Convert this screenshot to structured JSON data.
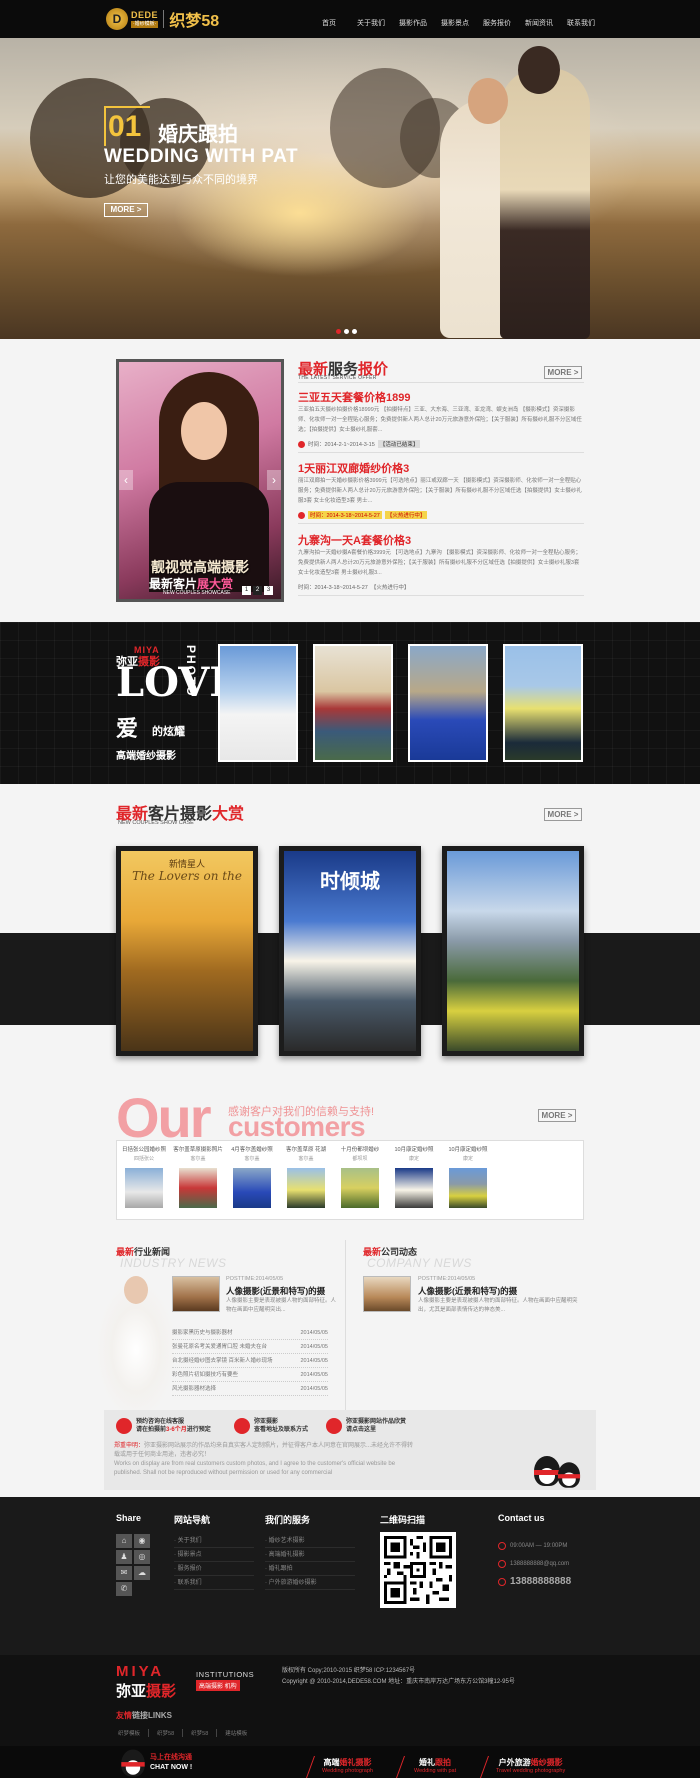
{
  "header": {
    "logo_badge": "D",
    "logo_text": "DEDE",
    "logo_subtext": "·婚纱模板·",
    "logo_name": "织梦58",
    "nav": [
      "首页",
      "关于我们",
      "摄影作品",
      "摄影景点",
      "服务报价",
      "新闻资讯",
      "联系我们"
    ]
  },
  "banner": {
    "number": "01",
    "title_cn": "婚庆跟拍",
    "title_en": "WEDDING WITH PAT",
    "subtitle": "让您的美能达到与众不同的境界",
    "more": "MORE >",
    "active_slide": 1,
    "slides": 3
  },
  "services": {
    "title_red": "最新",
    "title_dark": "服务",
    "title_red2": "报价",
    "title_en": "THE LATEST SERVICE OFFER",
    "more": "MORE >",
    "photo": {
      "caption1": "靓视觉高端摄影",
      "caption2_a": "最新客片",
      "caption2_b": "展大赏",
      "caption3": "NEW COUPLES SHOWCASE",
      "pages": [
        "1",
        "2",
        "3"
      ],
      "active_page": "2",
      "prev": "‹",
      "next": "›"
    },
    "items": [
      {
        "title": "三亚五天套餐价格1899",
        "desc": "三亚拍五天摄纱拍摄价格18999元 【拍摄特点】三亚、大东海、三亚湾、亚龙湾、蜈支洲岛 【摄影模式】资深摄影师、化妆师一对一全程贴心服务；免费提供新人两人总计20万元旅游意外保险；【关于服装】所有摄纱礼服不分区域任选；【拍摄提供】女士摄纱礼服套...",
        "date": "时间：2014-2-1~2014-3-15",
        "tag": "【活动已结束】"
      },
      {
        "title": "1天丽江双廊婚纱价格3",
        "desc": "丽江双廊拍一天婚纱摄影价格3999元【可选地点】丽江或双廊一天 【摄影模式】资深摄影师、化妆师一对一全程贴心服务；免费提供新人两人总计20万元旅游意外保险；【关于服装】所有摄纱礼服不分区域任选【拍摄提供】女士摄纱礼服3套 女士化妆造型3套 男士...",
        "date": "时间：2014-3-18~2014-5-27",
        "tag": "【火热进行中】"
      },
      {
        "title": "九寨沟一天A套餐价格3",
        "desc": "九寨沟拍一天婚纱摄A套餐价格3999元 【可选地点】九寨沟 【摄影模式】资深摄影师、化妆师一对一全程贴心服务；免费提供新人两人总计20万元旅游意外保险；【关于服装】所有摄纱礼服不分区域任选【拍摄提供】女士摄纱礼服3套 女士化妆造型3套 男士摄纱礼服3...",
        "date": "时间：2014-3-18~2014-5-27",
        "tag": "【火热进行中】"
      }
    ]
  },
  "miya": {
    "top": "MIYA",
    "line1_a": "弥亚",
    "line1_b": "摄影",
    "love": "LOVE",
    "photo": "PHOTO",
    "ai": "爱",
    "xy": "的炫耀",
    "gd": "高端婚纱摄影"
  },
  "customers": {
    "title_red": "最新",
    "title_dark": "客片摄影",
    "title_red2": "大赏",
    "title_en": "NEW COUPLES SHOW CASE",
    "more": "MORE >",
    "cards": [
      "新情星人",
      "时倾城",
      ""
    ],
    "card1_sub": "The Lovers on the"
  },
  "our_customers": {
    "big": "Our",
    "cn": "感谢客户对我们的信赖与支持!",
    "en": "customers",
    "more": "MORE >",
    "columns": [
      {
        "h1": "日括张公园婚纱照",
        "h2": "四括张公"
      },
      {
        "h1": "客尔盖草原摄影照片",
        "h2": "客尔盖"
      },
      {
        "h1": "4月客尔盖婚纱照",
        "h2": "客尔盖"
      },
      {
        "h1": "客尔盖草原 花湖",
        "h2": "客尔盖"
      },
      {
        "h1": "十月份都坝婚纱",
        "h2": "都坝坝"
      },
      {
        "h1": "10月康定婚纱照",
        "h2": "康定"
      },
      {
        "h1": "10月康定婚纱照",
        "h2": "康定"
      }
    ]
  },
  "news": {
    "industry": {
      "head_red": "最新",
      "head_dark": "行业新闻",
      "en": "INDUSTRY NEWS",
      "posttime": "POSTTIME:2014/05/05",
      "title": "人像摄影(近景和特写)的摄",
      "desc": "人像摄影主要是表现被摄人物的面部特征。人物在画面中应醒明突出...",
      "rows": [
        {
          "t": "摄影家黑历史与摄影器材",
          "d": "2014/05/05"
        },
        {
          "t": "张曼花原名考关爱通胃口腔 未婚夫在台",
          "d": "2014/05/05"
        },
        {
          "t": "台北摄经婚纱图去掌镜 百米新人婚纱现场",
          "d": "2014/05/05"
        },
        {
          "t": "彩色照片初如摄技巧有要些",
          "d": "2014/05/05"
        },
        {
          "t": "风光摄影器材选择",
          "d": "2014/05/05"
        }
      ]
    },
    "company": {
      "head_red": "最新",
      "head_dark": "公司动态",
      "en": "COMPANY NEWS",
      "posttime": "POSTTIME:2014/05/05",
      "title": "人像摄影(近景和特写)的摄",
      "desc": "人像摄影主要是表现被摄人物的面部特征。人物在画面中应醒明突出，尤其是面部表情传达的神态美..."
    }
  },
  "contact_strip": {
    "items": [
      {
        "a": "预约咨询在线客服",
        "b": "请在拍摄前",
        "c": "3-6个月",
        "d": "进行预定"
      },
      {
        "a": "弥亚摄影",
        "b": "查看地址及联系方式",
        "c": "",
        "d": ""
      },
      {
        "a": "弥亚摄影网站作品欣赏",
        "b": "请点击这里",
        "c": "",
        "d": ""
      }
    ],
    "notice_cn": "郑重申明：",
    "notice": "弥亚摄影网站展示的作品均来自真实客人定制照片，并征得客户本人同意在官网展示...未经允许不得转载或用于任何商业用途，违者必究！",
    "notice_en": "Works on display are from real customers custom photos, and I agree to the customer's official website be published. Shall not be reproduced without permission or used for any commercial"
  },
  "footer": {
    "share": "Share",
    "nav_head": "网站导航",
    "nav": [
      "关于我们",
      "摄影景点",
      "服务报价",
      "联系我们"
    ],
    "svc_head": "我们的服务",
    "svc": [
      "婚纱艺术摄影",
      "高端婚礼摄影",
      "婚礼跟拍",
      "户外旅游婚纱摄影"
    ],
    "qr_head": "二维码扫描",
    "contact_head": "Contact us",
    "hours": "09:00AM — 19:00PM",
    "email": "1388888888@qq.com",
    "phone": "13888888888"
  },
  "bottom": {
    "miya_top": "MIYA",
    "miya_a": "弥亚",
    "miya_b": "摄影",
    "institutions": "INSTITUTIONS",
    "tag": "高端摄影 机构",
    "copy1": "版权所有 Copy;2010-2015 织梦58 ICP:1234567号",
    "copy2": "Copyright @ 2010-2014,DEDE58.COM 地址：重庆市南岸万达广场东方公馆3幢12-95号",
    "links_red": "友情",
    "links_dark": "链接LINKS",
    "links": [
      "织梦模板",
      "织梦58",
      "织梦58",
      "建站模板"
    ],
    "chat1": "马上在线沟通",
    "chat2": "CHAT NOW !",
    "bar": [
      {
        "a": "高端",
        "r": "婚礼摄影",
        "b": "Wedding photograph"
      },
      {
        "a": "婚礼",
        "r": "跟拍",
        "b": "Wedding with pat"
      },
      {
        "a": "户外旅游",
        "r": "婚纱摄影",
        "b": "Travel wedding photography"
      }
    ]
  }
}
